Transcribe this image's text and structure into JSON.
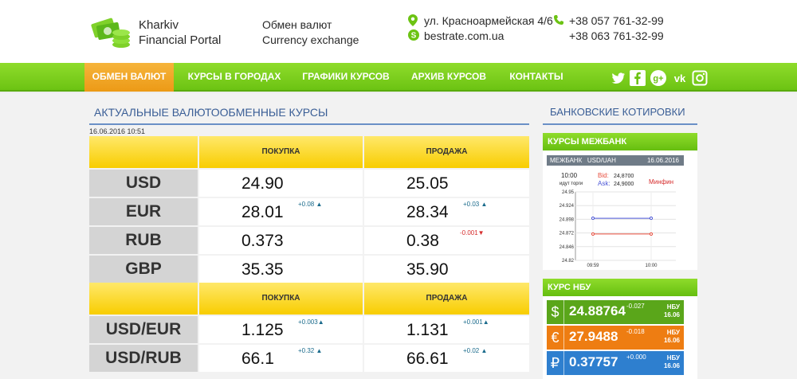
{
  "header": {
    "logo_line1": "Kharkiv",
    "logo_line2": "Financial Portal",
    "tagline_ru": "Обмен валют",
    "tagline_en": "Currency exchange",
    "address": "ул. Красноармейская 4/6",
    "website": "bestrate.com.ua",
    "phone1": "+38 057 761-32-99",
    "phone2": "+38 063 761-32-99"
  },
  "nav": {
    "items": [
      "ОБМЕН ВАЛЮТ",
      "КУРСЫ В ГОРОДАХ",
      "ГРАФИКИ КУРСОВ",
      "АРХИВ КУРСОВ",
      "КОНТАКТЫ"
    ],
    "social": [
      "twitter-icon",
      "facebook-icon",
      "google-plus-icon",
      "vk-icon",
      "instagram-icon"
    ]
  },
  "main": {
    "title": "АКТУАЛЬНЫЕ ВАЛЮТООБМЕННЫЕ КУРСЫ",
    "date": "16.06.2016 10:51",
    "buy_label": "ПОКУПКА",
    "sell_label": "ПРОДАЖА",
    "rows1": [
      {
        "cur": "USD",
        "buy": "24.90",
        "buy_chg": "",
        "sell": "25.05",
        "sell_chg": ""
      },
      {
        "cur": "EUR",
        "buy": "28.01",
        "buy_chg": "+0.08 ▲",
        "sell": "28.34",
        "sell_chg": "+0.03 ▲"
      },
      {
        "cur": "RUB",
        "buy": "0.373",
        "buy_chg": "",
        "sell": "0.38",
        "sell_chg": "-0.001▼"
      },
      {
        "cur": "GBP",
        "buy": "35.35",
        "buy_chg": "",
        "sell": "35.90",
        "sell_chg": ""
      }
    ],
    "rows2": [
      {
        "cur": "USD/EUR",
        "buy": "1.125",
        "buy_chg": "+0.003▲",
        "sell": "1.131",
        "sell_chg": "+0.001▲"
      },
      {
        "cur": "USD/RUB",
        "buy": "66.1",
        "buy_chg": "+0.32 ▲",
        "sell": "66.61",
        "sell_chg": "+0.02 ▲"
      }
    ]
  },
  "sidebar": {
    "title": "БАНКОВСКИЕ КОТИРОВКИ",
    "interbank_title": "КУРСЫ МЕЖБАНК",
    "interbank_bar_left": "МЕЖБАНК   USD/UAH",
    "interbank_bar_date": "16.06.2016",
    "chart_time": "10:00",
    "chart_status": "идут торги",
    "bid_label": "Bid:",
    "bid_value": "24,8700",
    "ask_label": "Ask:",
    "ask_value": "24,9000",
    "source": "Минфин",
    "nbu_title": "КУРС НБУ",
    "nbu": [
      {
        "sym": "$",
        "value": "24.88764",
        "delta": "-0.027",
        "tag1": "НБУ",
        "tag2": "16.06",
        "color": "#5aa61a"
      },
      {
        "sym": "€",
        "value": "27.9488",
        "delta": "-0.018",
        "tag1": "НБУ",
        "tag2": "16.06",
        "color": "#ee7d12"
      },
      {
        "sym": "₽",
        "value": "0.37757",
        "delta": "+0.000",
        "tag1": "НБУ",
        "tag2": "16.06",
        "color": "#2e7fcf"
      }
    ]
  },
  "chart_data": {
    "type": "line",
    "x": [
      "09:59",
      "10:00"
    ],
    "series": [
      {
        "name": "Bid",
        "values": [
          24.87,
          24.87
        ],
        "color": "#e74c3c"
      },
      {
        "name": "Ask",
        "values": [
          24.9,
          24.9
        ],
        "color": "#4a55d6"
      }
    ],
    "yticks": [
      "24.95",
      "24.924",
      "24.898",
      "24.872",
      "24.846",
      "24.82"
    ],
    "ylim": [
      24.82,
      24.95
    ]
  }
}
